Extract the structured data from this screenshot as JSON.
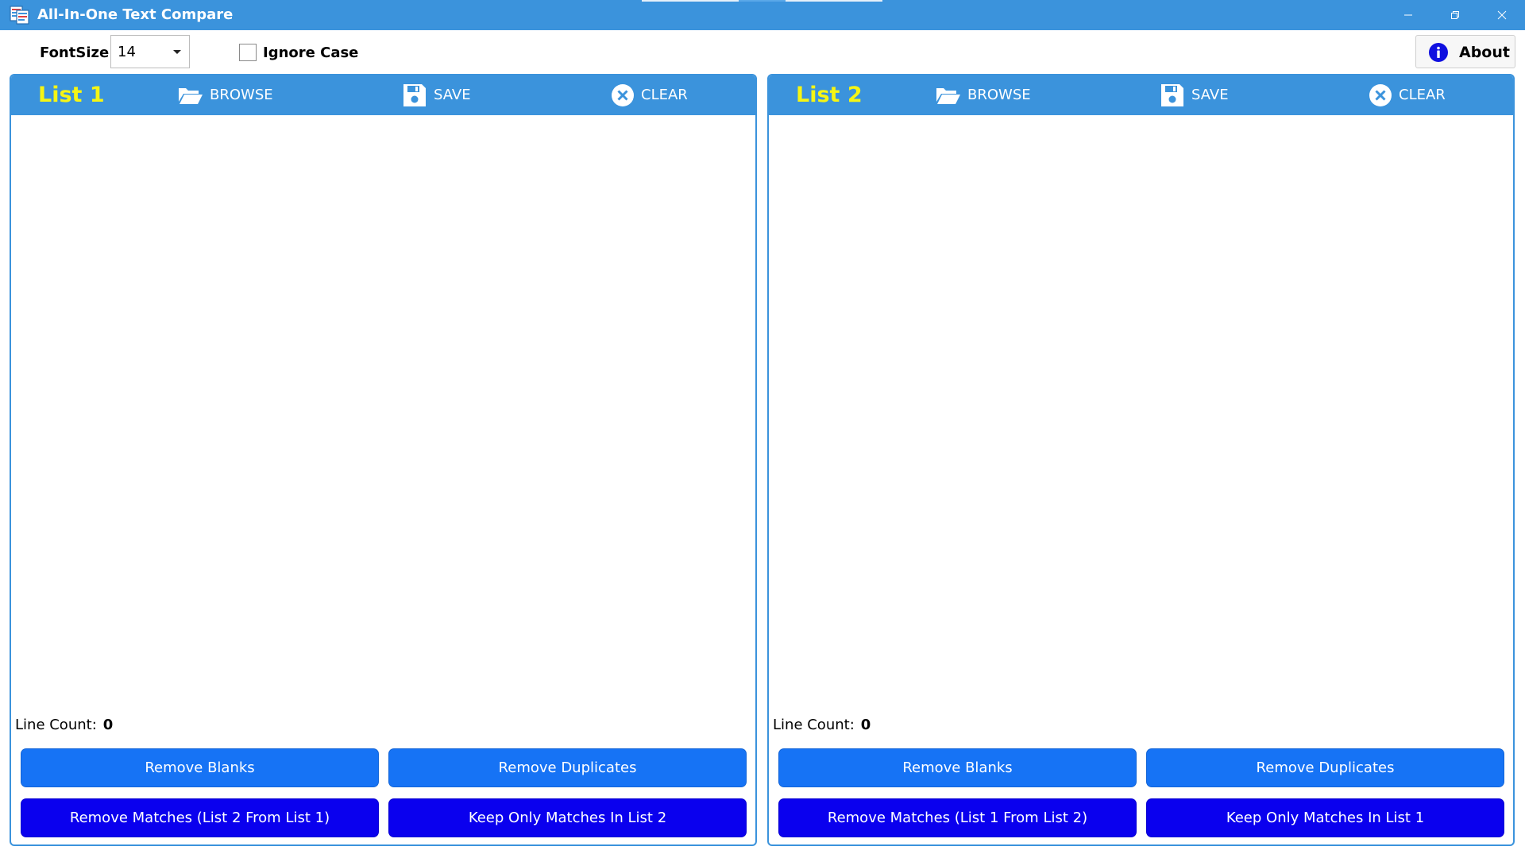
{
  "window": {
    "title": "All-In-One Text Compare"
  },
  "toolbar": {
    "fontsize_label": "FontSize:",
    "fontsize_value": "14",
    "ignore_case_label": "Ignore Case",
    "ignore_case_checked": false,
    "about_label": "About"
  },
  "icons": {
    "app": "text-compare-app-icon",
    "browse": "folder-open-icon",
    "save": "floppy-disk-icon",
    "clear": "close-circle-icon",
    "about": "info-icon",
    "minimize": "minimize-icon",
    "restore": "restore-icon",
    "close": "close-icon"
  },
  "colors": {
    "title_bar": "#3b93dc",
    "panel_header": "#3b93dc",
    "panel_title": "#f5f514",
    "action_light": "#1673f5",
    "action_dark": "#0a00ee"
  },
  "list1": {
    "title": "List 1",
    "browse_label": "BROWSE",
    "save_label": "SAVE",
    "clear_label": "CLEAR",
    "line_count_label": "Line Count:",
    "line_count_value": "0",
    "remove_blanks": "Remove Blanks",
    "remove_duplicates": "Remove Duplicates",
    "remove_matches": "Remove Matches (List 2 From List 1)",
    "keep_only_matches": "Keep Only Matches In List 2"
  },
  "list2": {
    "title": "List 2",
    "browse_label": "BROWSE",
    "save_label": "SAVE",
    "clear_label": "CLEAR",
    "line_count_label": "Line Count:",
    "line_count_value": "0",
    "remove_blanks": "Remove Blanks",
    "remove_duplicates": "Remove Duplicates",
    "remove_matches": "Remove Matches (List 1 From List 2)",
    "keep_only_matches": "Keep Only Matches In List 1"
  }
}
